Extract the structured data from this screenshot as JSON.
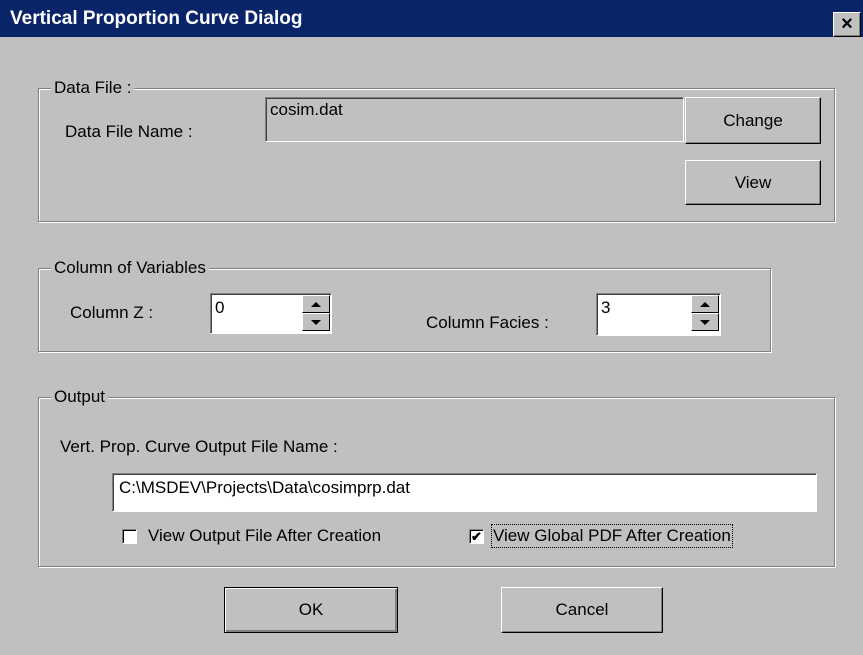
{
  "window": {
    "title": "Vertical Proportion Curve Dialog",
    "close_label": "×"
  },
  "data_file": {
    "legend": "Data File :",
    "name_label": "Data File Name :",
    "name_value": "cosim.dat",
    "change_label": "Change",
    "view_label": "View"
  },
  "columns": {
    "legend": "Column of Variables",
    "z_label": "Column Z :",
    "z_value": "0",
    "facies_label": "Column Facies :",
    "facies_value": "3"
  },
  "output": {
    "legend": "Output",
    "file_label": "Vert. Prop. Curve Output File Name :",
    "file_value": "C:\\MSDEV\\Projects\\Data\\cosimprp.dat",
    "view_output_label": "View Output File After Creation",
    "view_output_checked": false,
    "view_pdf_label": "View Global PDF After Creation",
    "view_pdf_checked": true,
    "check_mark": "✔"
  },
  "buttons": {
    "ok_label": "OK",
    "cancel_label": "Cancel"
  }
}
